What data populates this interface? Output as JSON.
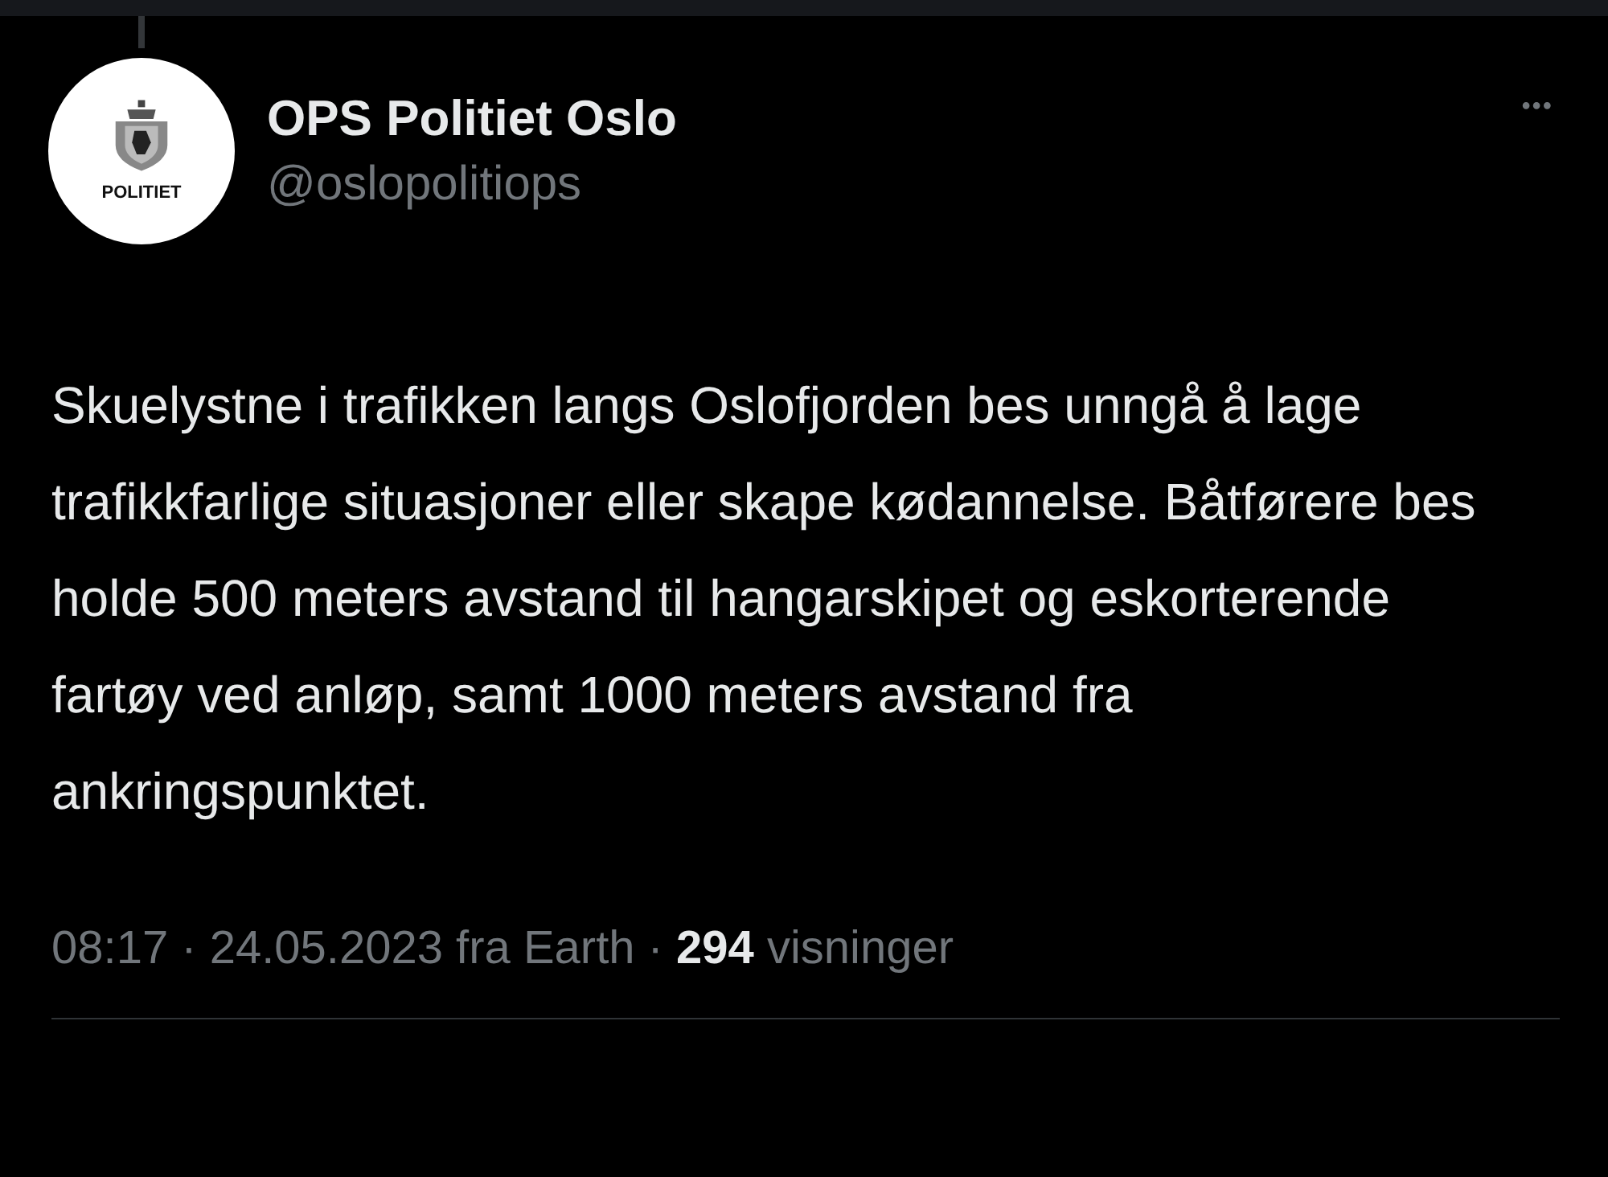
{
  "author": {
    "name": "OPS Politiet Oslo",
    "handle": "@oslopolitiops",
    "avatar_label": "POLITIET"
  },
  "more_button": "•••",
  "tweet": {
    "text": "Skuelystne i trafikken langs Oslofjorden bes unngå å lage trafikkfarlige situasjoner eller skape kødannelse. Båtførere bes holde 500 meters avstand til hangarskipet og eskorterende fartøy ved anløp, samt 1000 meters avstand fra ankringspunktet.",
    "meta": "08:17 · 24.05.2023 fra Earth · **294** visninger"
  }
}
